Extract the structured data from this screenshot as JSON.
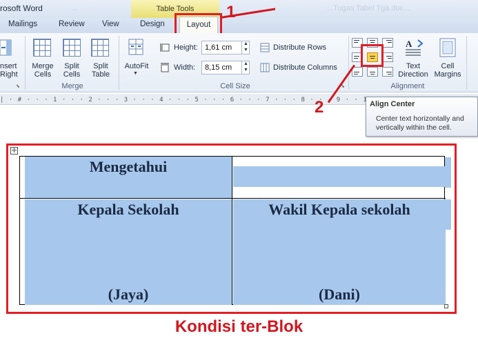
{
  "window": {
    "title": "rosoft Word",
    "contextual_tab_group": "Table Tools",
    "ghost_title_left": "...",
    "ghost_title_right": "...Tugas Tabel Tga.doc..."
  },
  "tabs": [
    {
      "label": "Mailings"
    },
    {
      "label": "Review"
    },
    {
      "label": "View"
    },
    {
      "label": "Design"
    },
    {
      "label": "Layout"
    }
  ],
  "annotations": {
    "one": "1",
    "two": "2",
    "caption": "Kondisi ter-Blok"
  },
  "ribbon": {
    "insert_right": "nsert\nRight",
    "merge_cells": "Merge\nCells",
    "split_cells": "Split\nCells",
    "split_table": "Split\nTable",
    "merge_group": "Merge",
    "autofit": "AutoFit",
    "height_label": "Height:",
    "height_value": "1,61 cm",
    "width_label": "Width:",
    "width_value": "8,15 cm",
    "distribute_rows": "Distribute Rows",
    "distribute_columns": "Distribute Columns",
    "cell_size_group": "Cell Size",
    "text_direction": "Text\nDirection",
    "cell_margins": "Cell\nMargins",
    "alignment_group": "Alignment"
  },
  "ruler": {
    "marks": "| · # · · · 1 · · · 2 · · · 3 · · · 4 · · · 5 · · · 6 · · · 7 · · · 8 · · · 9 · · 10 · · 11 · · 12 · · 13"
  },
  "tooltip": {
    "title": "Align Center",
    "body": "Center text horizontally and vertically within the cell."
  },
  "table": {
    "r1c1": "Mengetahui",
    "r2c1": "Kepala Sekolah",
    "r2c2": "Wakil Kepala sekolah",
    "r2c1_name": "(Jaya)",
    "r2c2_name": "(Dani)"
  },
  "colors": {
    "selection": "#a7c8ec",
    "annotation_red": "#e21e25",
    "table_tools_tab": "#e9df74"
  }
}
